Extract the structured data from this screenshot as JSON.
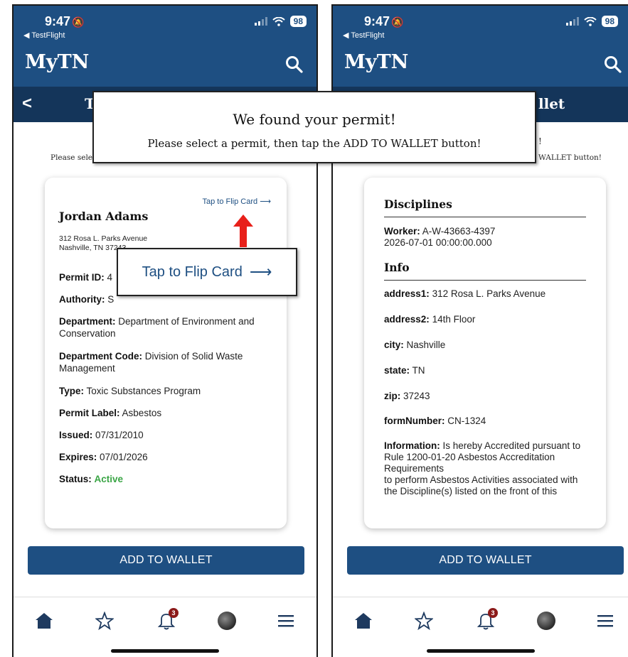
{
  "status_bar": {
    "time": "9:47",
    "back_app": "◀ TestFlight",
    "battery": "98"
  },
  "header": {
    "brand": "MyTN"
  },
  "left": {
    "subbar_title": "T",
    "instruction": "Please selec",
    "card": {
      "flip_link": "Tap to Flip Card",
      "name": "Jordan Adams",
      "address_line1": "312 Rosa L. Parks Avenue",
      "address_line2": "Nashville, TN 37243",
      "permit_id_label": "Permit ID:",
      "permit_id_value": "4",
      "authority_label": "Authority:",
      "authority_value": "S",
      "department_label": "Department:",
      "department_value": "Department of Environment and Conservation",
      "department_code_label": "Department Code:",
      "department_code_value": "Division of Solid Waste Management",
      "type_label": "Type:",
      "type_value": "Toxic Substances Program",
      "permit_label_label": "Permit Label:",
      "permit_label_value": "Asbestos",
      "issued_label": "Issued:",
      "issued_value": "07/31/2010",
      "expires_label": "Expires:",
      "expires_value": "07/01/2026",
      "status_label": "Status:",
      "status_value": "Active"
    },
    "add_button": "ADD TO WALLET"
  },
  "right": {
    "subbar_title": "llet",
    "instruction_top": "!",
    "instruction": "WALLET button!",
    "card": {
      "disciplines_title": "Disciplines",
      "worker_label": "Worker:",
      "worker_value": "A-W-43663-4397",
      "worker_date": "2026-07-01 00:00:00.000",
      "info_title": "Info",
      "address1_label": "address1:",
      "address1_value": "312 Rosa L. Parks Avenue",
      "address2_label": "address2:",
      "address2_value": "14th Floor",
      "city_label": "city:",
      "city_value": "Nashville",
      "state_label": "state:",
      "state_value": "TN",
      "zip_label": "zip:",
      "zip_value": "37243",
      "form_label": "formNumber:",
      "form_value": "CN-1324",
      "information_label": "Information:",
      "information_value": "Is hereby Accredited pursuant to Rule 1200-01-20 Asbestos Accreditation Requirements",
      "information_value2": "to perform Asbestos Activities associated with the Discipline(s) listed on the front of this"
    },
    "add_button": "ADD TO WALLET"
  },
  "tabbar": {
    "notification_count": "3"
  },
  "modal": {
    "title": "We found your permit!",
    "text": "Please select a permit, then tap the ADD TO WALLET button!"
  },
  "callout": {
    "text": "Tap to Flip Card"
  },
  "colors": {
    "brand_blue": "#1e4f82",
    "subbar_navy": "#14355a",
    "active_green": "#3aa545",
    "annotation_red": "#e8201a"
  }
}
